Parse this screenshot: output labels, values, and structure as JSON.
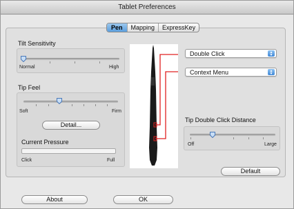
{
  "window": {
    "title": "Tablet Preferences"
  },
  "tabs": [
    {
      "label": "Pen",
      "active": true
    },
    {
      "label": "Mapping",
      "active": false
    },
    {
      "label": "ExpressKey",
      "active": false
    }
  ],
  "tilt": {
    "title": "Tilt Sensitivity",
    "min_label": "Normal",
    "max_label": "High",
    "value_fraction": 0.0
  },
  "tip_feel": {
    "title": "Tip Feel",
    "min_label": "Soft",
    "max_label": "Firm",
    "value_fraction": 0.3,
    "detail_button": "Detail..."
  },
  "pressure": {
    "title": "Current Pressure",
    "min_label": "Click",
    "max_label": "Full",
    "value_fraction": 0.0
  },
  "pen_buttons": {
    "upper": {
      "value": "Double Click"
    },
    "lower": {
      "value": "Context Menu"
    }
  },
  "tip_double_click": {
    "title": "Tip Double Click Distance",
    "min_label": "Off",
    "max_label": "Large",
    "value_fraction": 0.3
  },
  "buttons": {
    "default": "Default",
    "about": "About",
    "ok": "OK"
  },
  "colors": {
    "accent": "#5b9ede",
    "callout_line": "#e02020",
    "pen_body": "#1a1a1a"
  },
  "icons": {
    "dropdown": "up-down-arrows-icon",
    "slider_thumb": "slider-pointer-icon"
  }
}
